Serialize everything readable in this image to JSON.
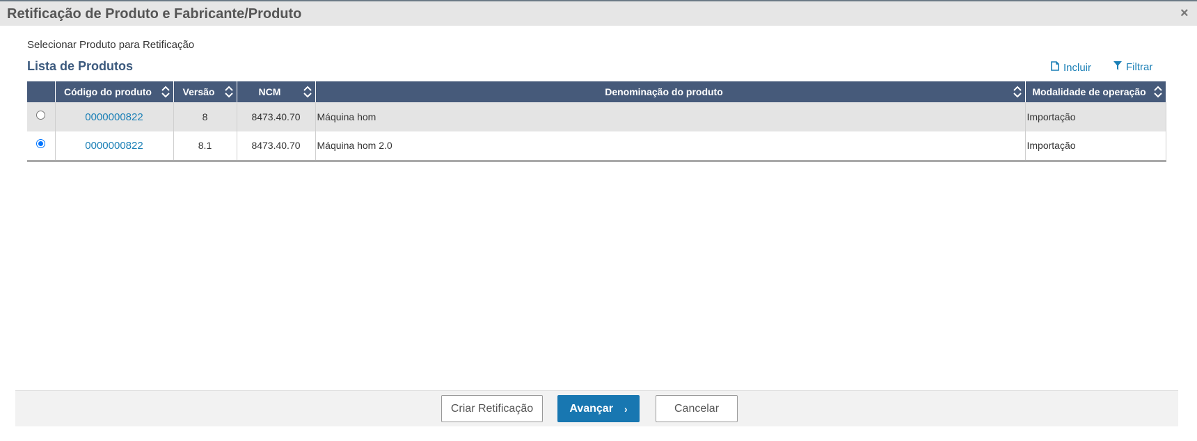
{
  "dialog": {
    "title": "Retificação de Produto e Fabricante/Produto",
    "close_icon": "×"
  },
  "subtitle": "Selecionar Produto para Retificação",
  "section_title": "Lista de Produtos",
  "actions": {
    "incluir": "Incluir",
    "filtrar": "Filtrar"
  },
  "table": {
    "columns": [
      "",
      "Código do produto",
      "Versão",
      "NCM",
      "Denominação do produto",
      "Modalidade de operação"
    ],
    "rows": [
      {
        "selected": false,
        "codigo": "0000000822",
        "versao": "8",
        "ncm": "8473.40.70",
        "denominacao": "Máquina hom",
        "modalidade": "Importação"
      },
      {
        "selected": true,
        "codigo": "0000000822",
        "versao": "8.1",
        "ncm": "8473.40.70",
        "denominacao": "Máquina hom 2.0",
        "modalidade": "Importação"
      }
    ]
  },
  "footer": {
    "criar": "Criar Retificação",
    "avancar": "Avançar",
    "avancar_icon": "›",
    "cancelar": "Cancelar"
  },
  "colors": {
    "header_bg": "#465a7a",
    "link": "#1a7fb6",
    "primary_button": "#1877b1"
  }
}
